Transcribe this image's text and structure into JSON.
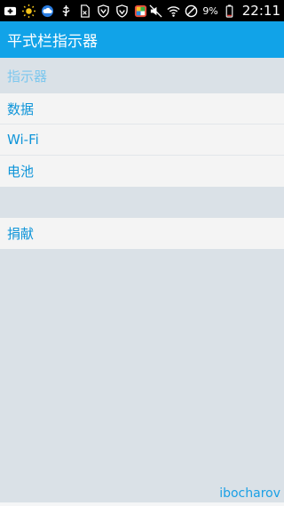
{
  "status_bar": {
    "left_icons": [
      "add-notification-icon",
      "sun-icon",
      "cloud-icon",
      "usb-icon",
      "sd-card-icon",
      "shield-icon",
      "shield-check-icon",
      "app-icon"
    ],
    "right_icons": [
      "mute-icon",
      "wifi-icon",
      "no-sim-icon"
    ],
    "battery_percent": "9%",
    "time": "22:11"
  },
  "app_bar": {
    "title": "平式栏指示器"
  },
  "section": {
    "header": "指示器"
  },
  "items": [
    {
      "label": "数据"
    },
    {
      "label": "Wi-Fi"
    },
    {
      "label": "电池"
    }
  ],
  "donate": {
    "label": "捐献"
  },
  "footer": {
    "author": "ibocharov"
  },
  "colors": {
    "app_bar": "#11a3e8",
    "item_text": "#0f95d9",
    "section_header": "#7cc7ee",
    "background": "#dae1e7"
  }
}
